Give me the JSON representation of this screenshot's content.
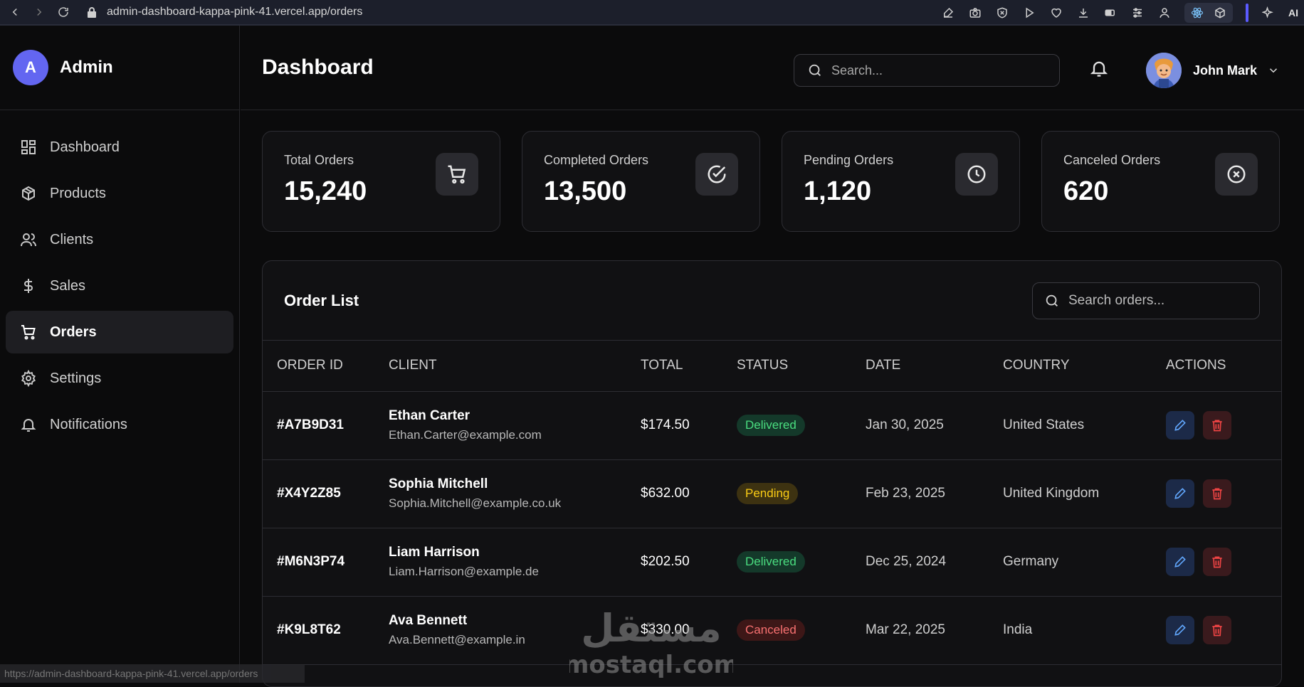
{
  "browser": {
    "url": "admin-dashboard-kappa-pink-41.vercel.app/orders",
    "ai_label": "AI",
    "status_link": "https://admin-dashboard-kappa-pink-41.vercel.app/orders"
  },
  "sidebar": {
    "brand_initial": "A",
    "brand_name": "Admin",
    "items": [
      {
        "label": "Dashboard",
        "icon": "grid-icon"
      },
      {
        "label": "Products",
        "icon": "box-icon"
      },
      {
        "label": "Clients",
        "icon": "users-icon"
      },
      {
        "label": "Sales",
        "icon": "dollar-icon"
      },
      {
        "label": "Orders",
        "icon": "cart-icon",
        "active": true
      },
      {
        "label": "Settings",
        "icon": "gear-icon"
      },
      {
        "label": "Notifications",
        "icon": "bell-icon"
      }
    ]
  },
  "header": {
    "title": "Dashboard",
    "search_placeholder": "Search...",
    "user_name": "John Mark"
  },
  "stats": [
    {
      "label": "Total Orders",
      "value": "15,240",
      "icon": "cart-icon"
    },
    {
      "label": "Completed Orders",
      "value": "13,500",
      "icon": "check-circle-icon"
    },
    {
      "label": "Pending Orders",
      "value": "1,120",
      "icon": "clock-icon"
    },
    {
      "label": "Canceled Orders",
      "value": "620",
      "icon": "x-circle-icon"
    }
  ],
  "orders": {
    "title": "Order List",
    "search_placeholder": "Search orders...",
    "columns": [
      "ORDER ID",
      "CLIENT",
      "TOTAL",
      "STATUS",
      "DATE",
      "COUNTRY",
      "ACTIONS"
    ],
    "rows": [
      {
        "id": "#A7B9D31",
        "name": "Ethan Carter",
        "email": "Ethan.Carter@example.com",
        "total": "$174.50",
        "status": "Delivered",
        "date": "Jan 30, 2025",
        "country": "United States"
      },
      {
        "id": "#X4Y2Z85",
        "name": "Sophia Mitchell",
        "email": "Sophia.Mitchell@example.co.uk",
        "total": "$632.00",
        "status": "Pending",
        "date": "Feb 23, 2025",
        "country": "United Kingdom"
      },
      {
        "id": "#M6N3P74",
        "name": "Liam Harrison",
        "email": "Liam.Harrison@example.de",
        "total": "$202.50",
        "status": "Delivered",
        "date": "Dec 25, 2024",
        "country": "Germany"
      },
      {
        "id": "#K9L8T62",
        "name": "Ava Bennett",
        "email": "Ava.Bennett@example.in",
        "total": "$330.00",
        "status": "Canceled",
        "date": "Mar 22, 2025",
        "country": "India"
      }
    ]
  },
  "colors": {
    "accent": "#6366f1",
    "delivered": "#4ade80",
    "pending": "#facc15",
    "canceled": "#f87171",
    "edit": "#60a5fa",
    "delete": "#ef4444"
  },
  "watermark": {
    "arabic": "مستقل",
    "latin": "mostaql.com"
  }
}
